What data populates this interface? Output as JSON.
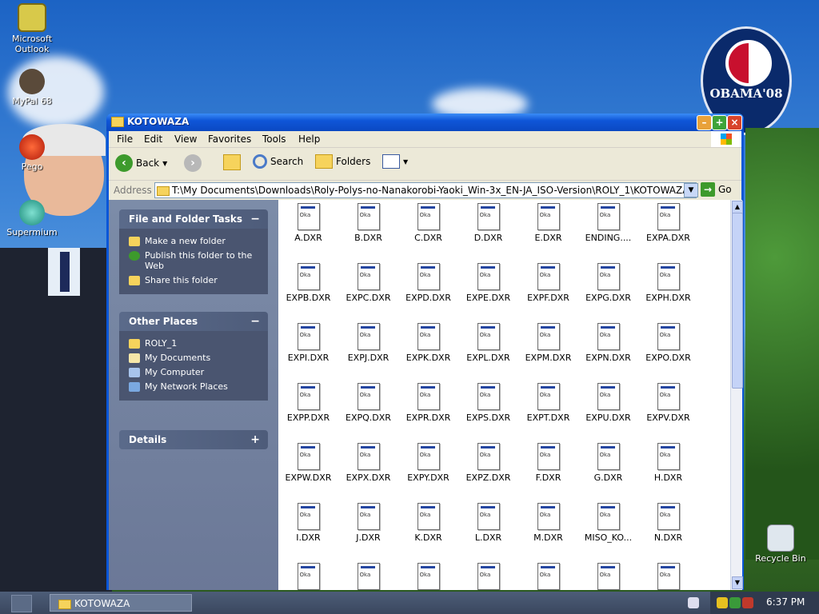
{
  "desktop": {
    "icons": [
      {
        "label": "Microsoft\nOutlook",
        "label_line1": "Microsoft",
        "label_line2": "Outlook"
      },
      {
        "label_line1": "MyPal 68"
      },
      {
        "label_line1": "Pego"
      },
      {
        "label_line1": "Supermium"
      }
    ],
    "recycle_bin": "Recycle Bin",
    "poster_text": "OBAMA'08"
  },
  "window": {
    "title": "KOTOWAZA",
    "menu": [
      "File",
      "Edit",
      "View",
      "Favorites",
      "Tools",
      "Help"
    ],
    "toolbar": {
      "back": "Back",
      "search": "Search",
      "folders": "Folders"
    },
    "address": {
      "label": "Address",
      "value": "T:\\My Documents\\Downloads\\Roly-Polys-no-Nanakorobi-Yaoki_Win-3x_EN-JA_ISO-Version\\ROLY_1\\KOTOWAZA",
      "go": "Go"
    },
    "panels": {
      "tasks": {
        "title": "File and Folder Tasks",
        "items": [
          "Make a new folder",
          "Publish this folder to the Web",
          "Share this folder"
        ]
      },
      "places": {
        "title": "Other Places",
        "items": [
          "ROLY_1",
          "My Documents",
          "My Computer",
          "My Network Places"
        ]
      },
      "details": {
        "title": "Details"
      }
    },
    "files": [
      "A.DXR",
      "B.DXR",
      "C.DXR",
      "D.DXR",
      "E.DXR",
      "ENDING....",
      "EXPA.DXR",
      "EXPB.DXR",
      "EXPC.DXR",
      "EXPD.DXR",
      "EXPE.DXR",
      "EXPF.DXR",
      "EXPG.DXR",
      "EXPH.DXR",
      "EXPI.DXR",
      "EXPJ.DXR",
      "EXPK.DXR",
      "EXPL.DXR",
      "EXPM.DXR",
      "EXPN.DXR",
      "EXPO.DXR",
      "EXPP.DXR",
      "EXPQ.DXR",
      "EXPR.DXR",
      "EXPS.DXR",
      "EXPT.DXR",
      "EXPU.DXR",
      "EXPV.DXR",
      "EXPW.DXR",
      "EXPX.DXR",
      "EXPY.DXR",
      "EXPZ.DXR",
      "F.DXR",
      "G.DXR",
      "H.DXR",
      "I.DXR",
      "J.DXR",
      "K.DXR",
      "L.DXR",
      "M.DXR",
      "MISO_KO...",
      "N.DXR",
      "",
      "",
      "",
      "",
      "",
      "",
      ""
    ]
  },
  "taskbar": {
    "task": "KOTOWAZA",
    "clock": "6:37 PM"
  }
}
